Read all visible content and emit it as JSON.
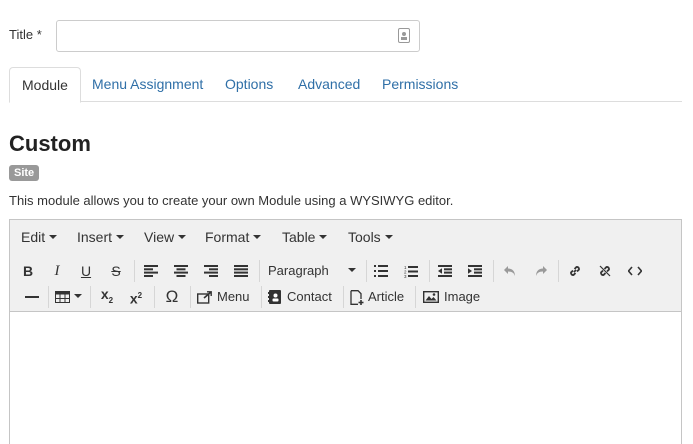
{
  "form": {
    "title_label": "Title *",
    "title_value": "",
    "title_placeholder": ""
  },
  "tabs": [
    {
      "label": "Module",
      "active": true
    },
    {
      "label": "Menu Assignment",
      "active": false
    },
    {
      "label": "Options",
      "active": false
    },
    {
      "label": "Advanced",
      "active": false
    },
    {
      "label": "Permissions",
      "active": false
    }
  ],
  "module": {
    "title": "Custom",
    "badge": "Site",
    "description": "This module allows you to create your own Module using a WYSIWYG editor."
  },
  "editor": {
    "menubar": [
      "Edit",
      "Insert",
      "View",
      "Format",
      "Table",
      "Tools"
    ],
    "format_select": "Paragraph",
    "buttons": {
      "menu": "Menu",
      "contact": "Contact",
      "article": "Article",
      "image": "Image"
    },
    "content": ""
  },
  "colors": {
    "link": "#2f6fa7",
    "badge_bg": "#999999",
    "toolbar_bg": "#f0f0f0",
    "border": "#c5c5c5"
  },
  "icons": {
    "bold": "bold-icon",
    "italic": "italic-icon",
    "underline": "underline-icon",
    "strikethrough": "strikethrough-icon",
    "align_left": "align-left-icon",
    "align_center": "align-center-icon",
    "align_right": "align-right-icon",
    "justify": "justify-icon",
    "bullet_list": "bullet-list-icon",
    "numbered_list": "numbered-list-icon",
    "outdent": "outdent-icon",
    "indent": "indent-icon",
    "undo": "undo-icon",
    "redo": "redo-icon",
    "link": "link-icon",
    "unlink": "unlink-icon",
    "code": "code-icon",
    "hr": "horizontal-rule-icon",
    "table": "table-icon",
    "subscript": "subscript-icon",
    "superscript": "superscript-icon",
    "special_char": "omega-icon",
    "menu": "menu-link-icon",
    "contact": "contact-icon",
    "article": "article-icon",
    "image": "image-icon"
  }
}
